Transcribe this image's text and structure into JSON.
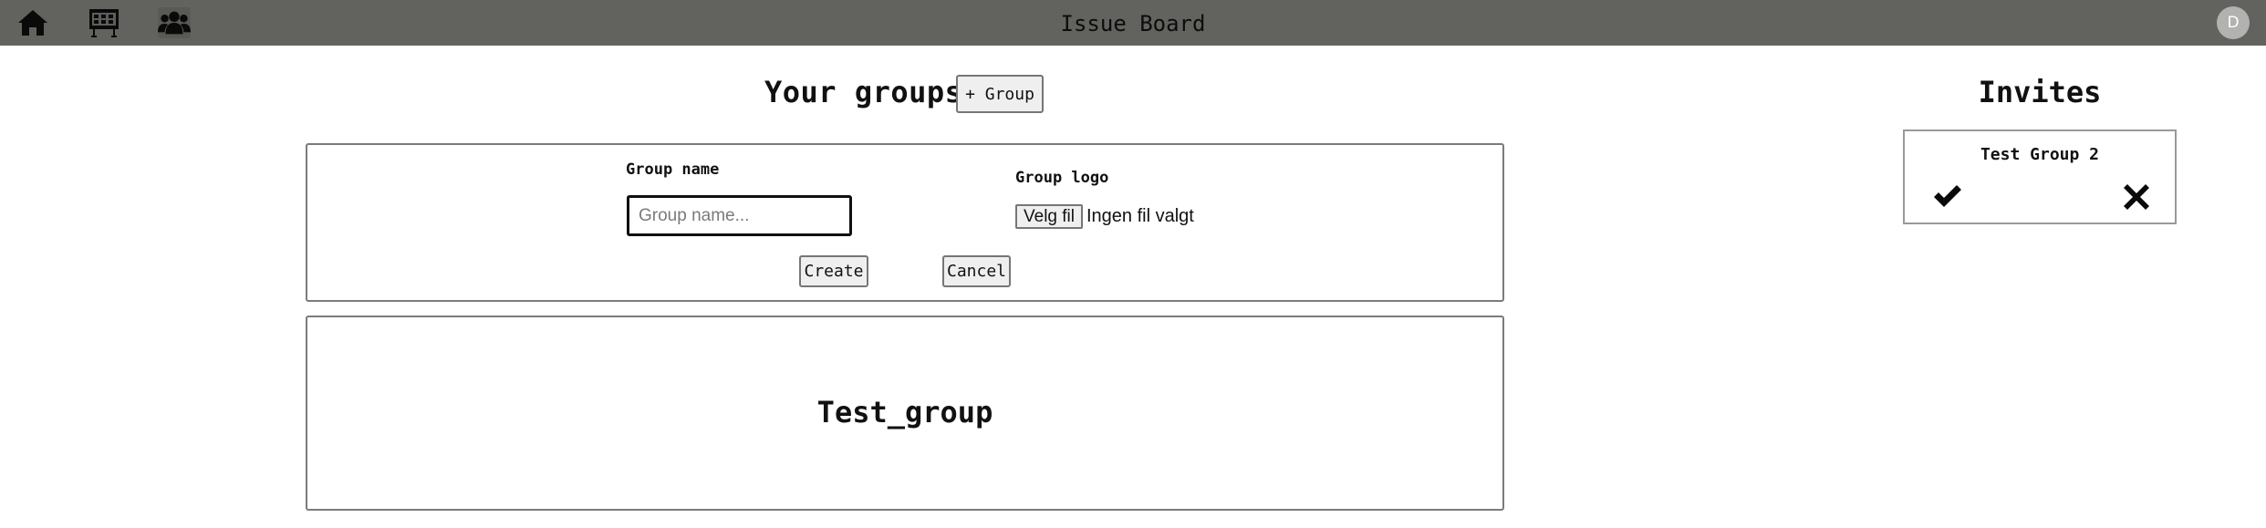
{
  "header": {
    "title": "Issue Board",
    "avatar_initial": "D",
    "nav": [
      {
        "name": "home",
        "icon": "home-icon"
      },
      {
        "name": "board",
        "icon": "board-icon"
      },
      {
        "name": "groups",
        "icon": "users-icon"
      }
    ]
  },
  "groups": {
    "heading": "Your groups",
    "add_label": "+ Group",
    "form": {
      "name_label": "Group name",
      "name_placeholder": "Group name...",
      "name_value": "",
      "logo_label": "Group logo",
      "file_button": "Velg fil",
      "file_status": "Ingen fil valgt",
      "create_label": "Create",
      "cancel_label": "Cancel"
    },
    "items": [
      {
        "name": "Test_group"
      }
    ]
  },
  "invites": {
    "heading": "Invites",
    "items": [
      {
        "name": "Test Group 2",
        "accept_icon": "check-icon",
        "decline_icon": "close-icon"
      }
    ]
  },
  "colors": {
    "topbar": "#62635f",
    "button_bg": "#efefef",
    "border": "#7b7b7b"
  }
}
